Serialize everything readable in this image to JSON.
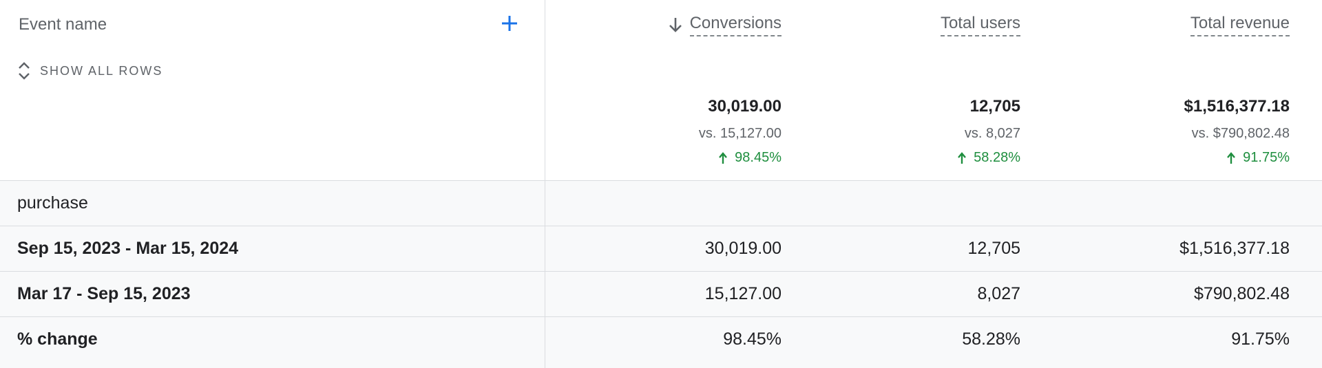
{
  "header": {
    "event_name_label": "Event name",
    "show_all_rows_label": "SHOW ALL ROWS",
    "columns": [
      {
        "title": "Conversions",
        "sorted": "descending"
      },
      {
        "title": "Total users"
      },
      {
        "title": "Total revenue"
      }
    ]
  },
  "totals": [
    {
      "value": "30,019.00",
      "vs": "vs. 15,127.00",
      "change": "98.45%"
    },
    {
      "value": "12,705",
      "vs": "vs. 8,027",
      "change": "58.28%"
    },
    {
      "value": "$1,516,377.18",
      "vs": "vs. $790,802.48",
      "change": "91.75%"
    }
  ],
  "rows": [
    {
      "label": "purchase",
      "values": [
        "",
        "",
        ""
      ]
    },
    {
      "label": "Sep 15, 2023 - Mar 15, 2024",
      "values": [
        "30,019.00",
        "12,705",
        "$1,516,377.18"
      ]
    },
    {
      "label": "Mar 17 - Sep 15, 2023",
      "values": [
        "15,127.00",
        "8,027",
        "$790,802.48"
      ]
    },
    {
      "label": "% change",
      "values": [
        "98.45%",
        "58.28%",
        "91.75%"
      ]
    }
  ],
  "colors": {
    "positive": "#1e8e3e",
    "accent": "#1a73e8",
    "row_bg": "#f8f9fa",
    "divider": "#dadce0"
  },
  "icons": {
    "add": "plus-icon",
    "expand": "unfold-icon",
    "sort": "arrow-down-icon",
    "trend": "arrow-up-icon"
  }
}
